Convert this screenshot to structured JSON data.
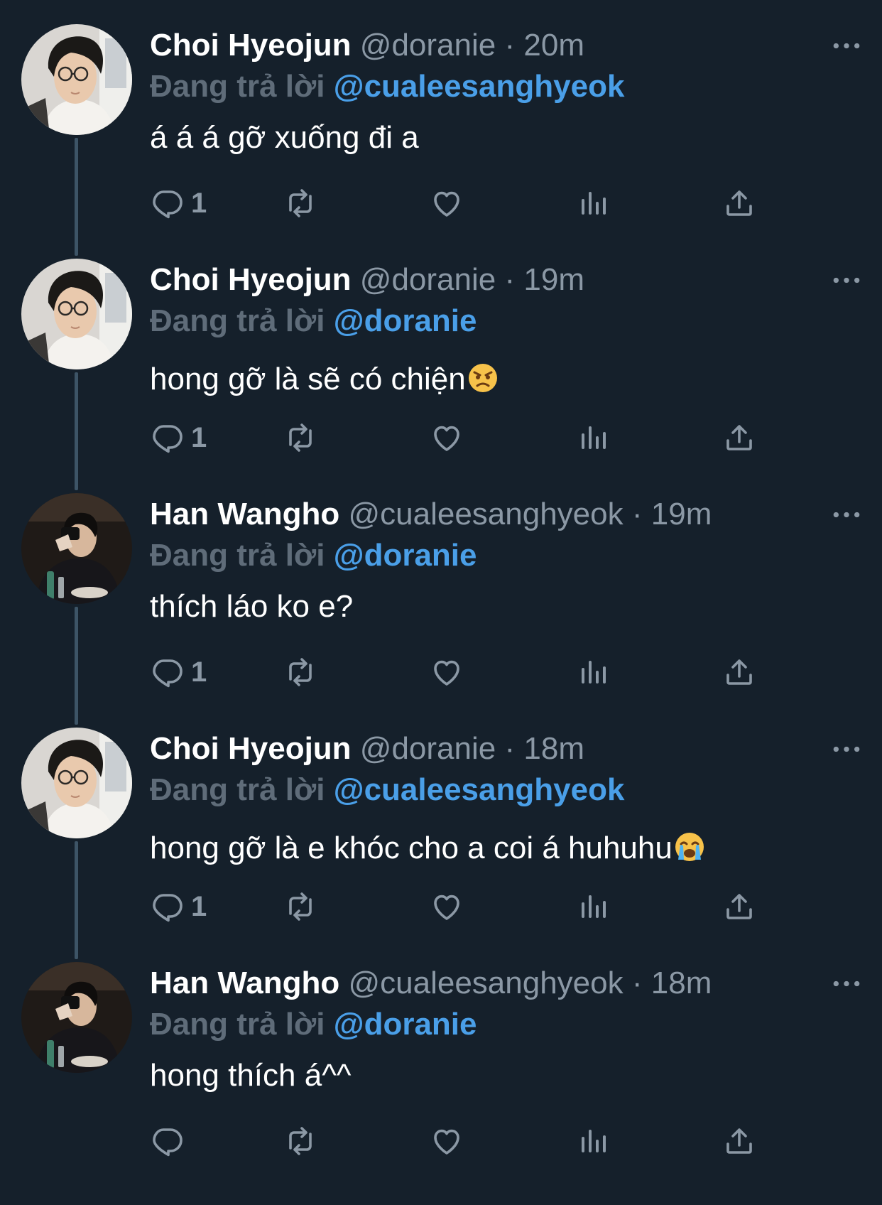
{
  "colors": {
    "background": "#15202b",
    "primary_text": "#ffffff",
    "secondary_text": "#8b98a5",
    "reply_prefix": "#5f6c79",
    "mention": "#4a9fe8",
    "thread_line": "#3d5466"
  },
  "tweets": [
    {
      "name": "Choi Hyeojun",
      "handle": "@doranie",
      "separator": "·",
      "time": "20m",
      "reply_prefix": "Đang trả lời",
      "reply_to": "@cualeesanghyeok",
      "text": "á á á gỡ xuống đi a",
      "emoji": "",
      "reply_count": "1",
      "avatar": "avatar-choi"
    },
    {
      "name": "Choi Hyeojun",
      "handle": "@doranie",
      "separator": "·",
      "time": "19m",
      "reply_prefix": "Đang trả lời",
      "reply_to": "@doranie",
      "text": "hong gỡ là sẽ có chiện",
      "emoji": "angry-face-emoji",
      "reply_count": "1",
      "avatar": "avatar-choi"
    },
    {
      "name": "Han Wangho",
      "handle": "@cualeesanghyeok",
      "separator": "·",
      "time": "19m",
      "reply_prefix": "Đang trả lời",
      "reply_to": "@doranie",
      "text": "thích láo ko e?",
      "emoji": "",
      "reply_count": "1",
      "avatar": "avatar-han"
    },
    {
      "name": "Choi Hyeojun",
      "handle": "@doranie",
      "separator": "·",
      "time": "18m",
      "reply_prefix": "Đang trả lời",
      "reply_to": "@cualeesanghyeok",
      "text": "hong gỡ là e khóc cho a coi á huhuhu",
      "emoji": "loudly-crying-face-emoji",
      "reply_count": "1",
      "avatar": "avatar-choi"
    },
    {
      "name": "Han Wangho",
      "handle": "@cualeesanghyeok",
      "separator": "·",
      "time": "18m",
      "reply_prefix": "Đang trả lời",
      "reply_to": "@doranie",
      "text": "hong thích á^^",
      "emoji": "",
      "reply_count": "",
      "avatar": "avatar-han"
    }
  ],
  "icons": {
    "reply": "reply-icon",
    "retweet": "retweet-icon",
    "like": "heart-icon",
    "analytics": "analytics-icon",
    "share": "share-icon",
    "more": "more-icon"
  }
}
